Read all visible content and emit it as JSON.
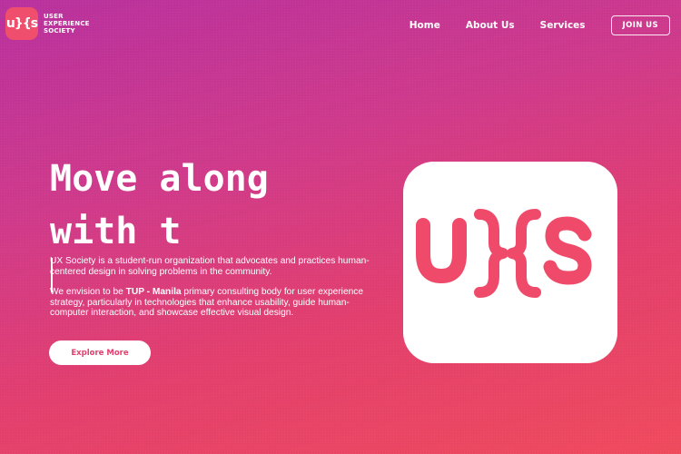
{
  "brand": {
    "logo_text": "u}{s",
    "name_lines": [
      "USER",
      "EXPERIENCE",
      "SOCIETY"
    ]
  },
  "nav": {
    "items": [
      "Home",
      "About Us",
      "Services"
    ],
    "join_label": "JOIN US"
  },
  "hero": {
    "title_line1": "Move along",
    "title_line2": "with t",
    "para1": "UX Society is a student-run organization that advocates and practices human-centered design in solving problems in the community.",
    "para2_prefix": "We envision to be ",
    "para2_bold": "TUP - Manila",
    "para2_suffix": " primary consulting body for user experience strategy, particularly in technologies that enhance usability, guide human-computer interaction, and showcase effective visual design.",
    "cta_label": "Explore More"
  },
  "colors": {
    "accent": "#ef4f6c",
    "gradient_top": "#b8319e",
    "gradient_bottom": "#ef4a5c"
  },
  "icons": {
    "brand_logo": "uxs-logo-icon",
    "hero_logo": "uxs-logo-icon"
  }
}
